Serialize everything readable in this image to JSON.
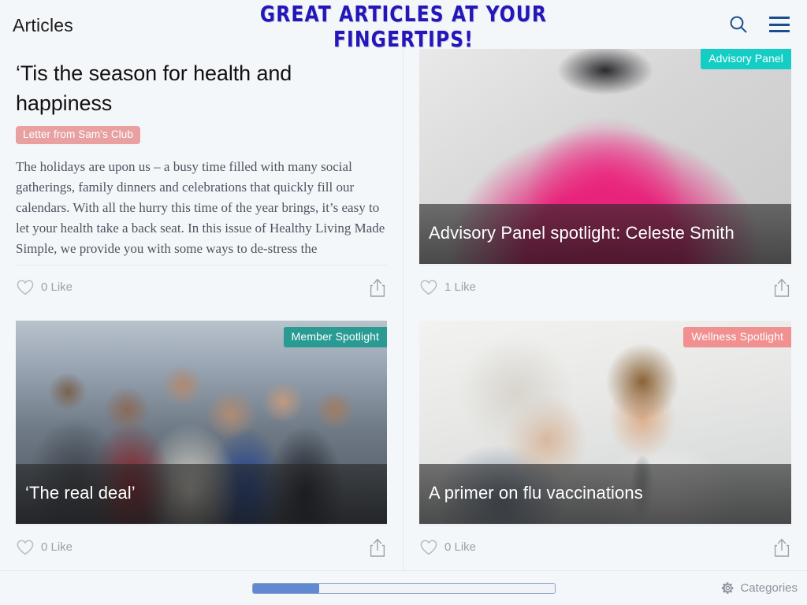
{
  "header": {
    "title": "Articles",
    "promo_line1": "GREAT ARTICLES AT YOUR",
    "promo_line2": "FINGERTIPS!",
    "promo_color": "#2416b8",
    "search_icon": "search-icon",
    "menu_icon": "hamburger-menu-icon",
    "icon_color": "#1a4f8f"
  },
  "articles": [
    {
      "type": "text",
      "title": "‘Tis the season for health and happiness",
      "tag": "Letter from Sam’s Club",
      "tag_color": "#e8a0a0",
      "body": "The holidays are upon us – a busy time filled with many social gatherings, family dinners and celebrations that quickly fill our calendars. With all the hurry this time of the year brings, it’s easy to let your health take a back seat. In this issue of Healthy Living Made Simple, we provide you with some ways to de-stress the",
      "like_count": "0 Like",
      "like_icon": "heart-outline-icon",
      "share_icon": "share-icon"
    },
    {
      "type": "image",
      "caption": "Advisory Panel spotlight: Celeste Smith",
      "badge": "Advisory Panel",
      "badge_color": "#14cec6",
      "like_count": "1 Like",
      "like_icon": "heart-outline-icon",
      "share_icon": "share-icon"
    },
    {
      "type": "image",
      "caption": "‘The real deal’",
      "badge": "Member Spotlight",
      "badge_color": "#2a9b93",
      "like_count": "0 Like",
      "like_icon": "heart-outline-icon",
      "share_icon": "share-icon"
    },
    {
      "type": "image",
      "caption": "A primer on flu vaccinations",
      "badge": "Wellness Spotlight",
      "badge_color": "#f09090",
      "like_count": "0 Like",
      "like_icon": "heart-outline-icon",
      "share_icon": "share-icon"
    }
  ],
  "footer": {
    "categories_label": "Categories",
    "categories_icon": "gear-icon",
    "pager_progress_percent": 22,
    "pager_fill_color": "#6189cf"
  }
}
